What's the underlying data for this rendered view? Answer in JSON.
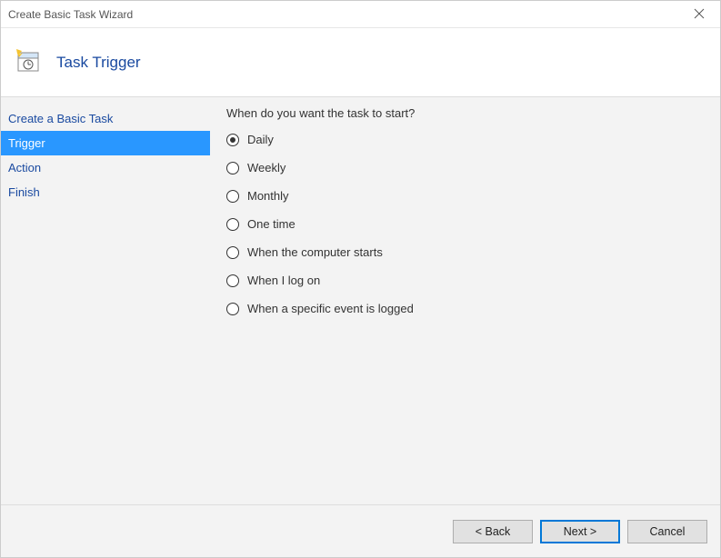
{
  "window": {
    "title": "Create Basic Task Wizard"
  },
  "header": {
    "title": "Task Trigger"
  },
  "sidebar": {
    "items": [
      {
        "label": "Create a Basic Task",
        "selected": false
      },
      {
        "label": "Trigger",
        "selected": true
      },
      {
        "label": "Action",
        "selected": false
      },
      {
        "label": "Finish",
        "selected": false
      }
    ]
  },
  "main": {
    "prompt": "When do you want the task to start?",
    "options": [
      {
        "label": "Daily",
        "checked": true
      },
      {
        "label": "Weekly",
        "checked": false
      },
      {
        "label": "Monthly",
        "checked": false
      },
      {
        "label": "One time",
        "checked": false
      },
      {
        "label": "When the computer starts",
        "checked": false
      },
      {
        "label": "When I log on",
        "checked": false
      },
      {
        "label": "When a specific event is logged",
        "checked": false
      }
    ]
  },
  "footer": {
    "back": "< Back",
    "next": "Next >",
    "cancel": "Cancel"
  }
}
